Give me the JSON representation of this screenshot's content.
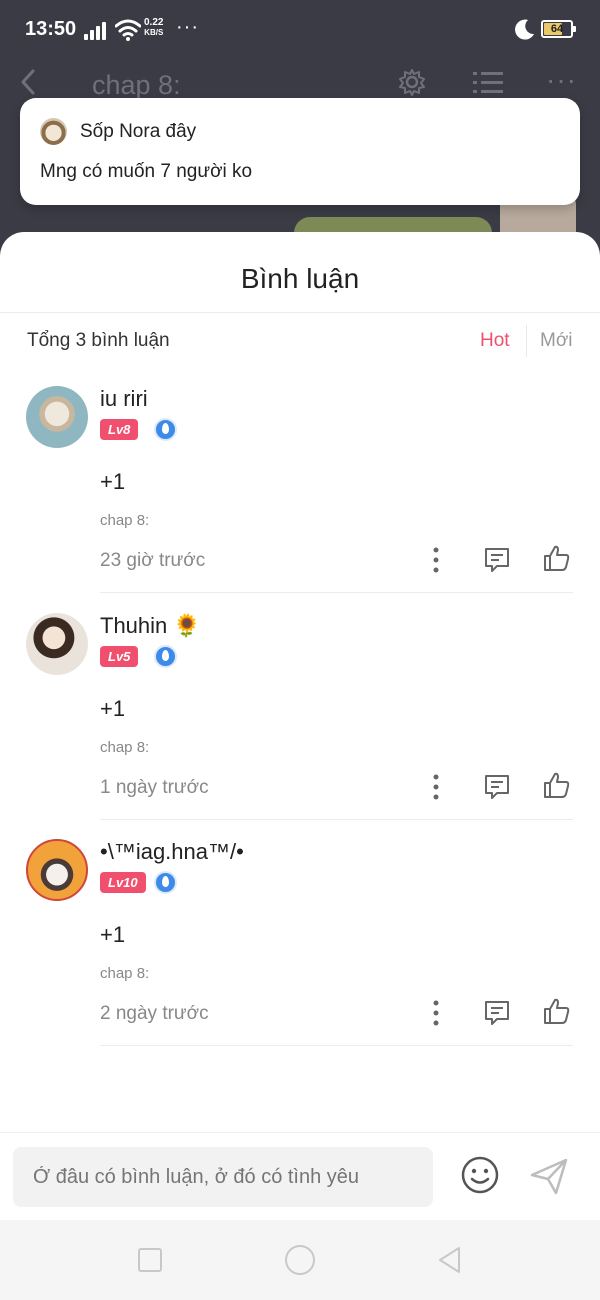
{
  "status_bar": {
    "time": "13:50",
    "net_speed_value": "0.22",
    "net_speed_unit": "KB/S",
    "more": "···",
    "battery": "64"
  },
  "background_page": {
    "title": "chap 8:"
  },
  "notification": {
    "sender": "Sốp Nora đây",
    "message": "Mng có muốn 7 người ko"
  },
  "comments_sheet": {
    "title": "Bình luận",
    "total_label": "Tổng 3 bình luận",
    "sort_hot": "Hot",
    "sort_new": "Mới",
    "comments": [
      {
        "name": "iu riri",
        "level": "Lv8",
        "text": "+1",
        "chapter": "chap 8:",
        "time": "23 giờ trước"
      },
      {
        "name": "Thuhin 🌻",
        "level": "Lv5",
        "text": "+1",
        "chapter": "chap 8:",
        "time": "1 ngày trước"
      },
      {
        "name": "•\\™iag.hna™/•",
        "level": "Lv10",
        "text": "+1",
        "chapter": "chap 8:",
        "time": "2 ngày trước"
      }
    ]
  },
  "input": {
    "placeholder": "Ở đâu có bình luận, ở đó có tình yêu"
  },
  "colors": {
    "accent": "#f0506e",
    "badge_blue": "#3d8ae8"
  },
  "icons": [
    "back-icon",
    "gear-icon",
    "list-icon",
    "more-icon",
    "reply-icon",
    "like-icon",
    "emoji-icon",
    "send-icon",
    "moon-icon",
    "wifi-icon",
    "signal-icon",
    "battery-icon"
  ]
}
